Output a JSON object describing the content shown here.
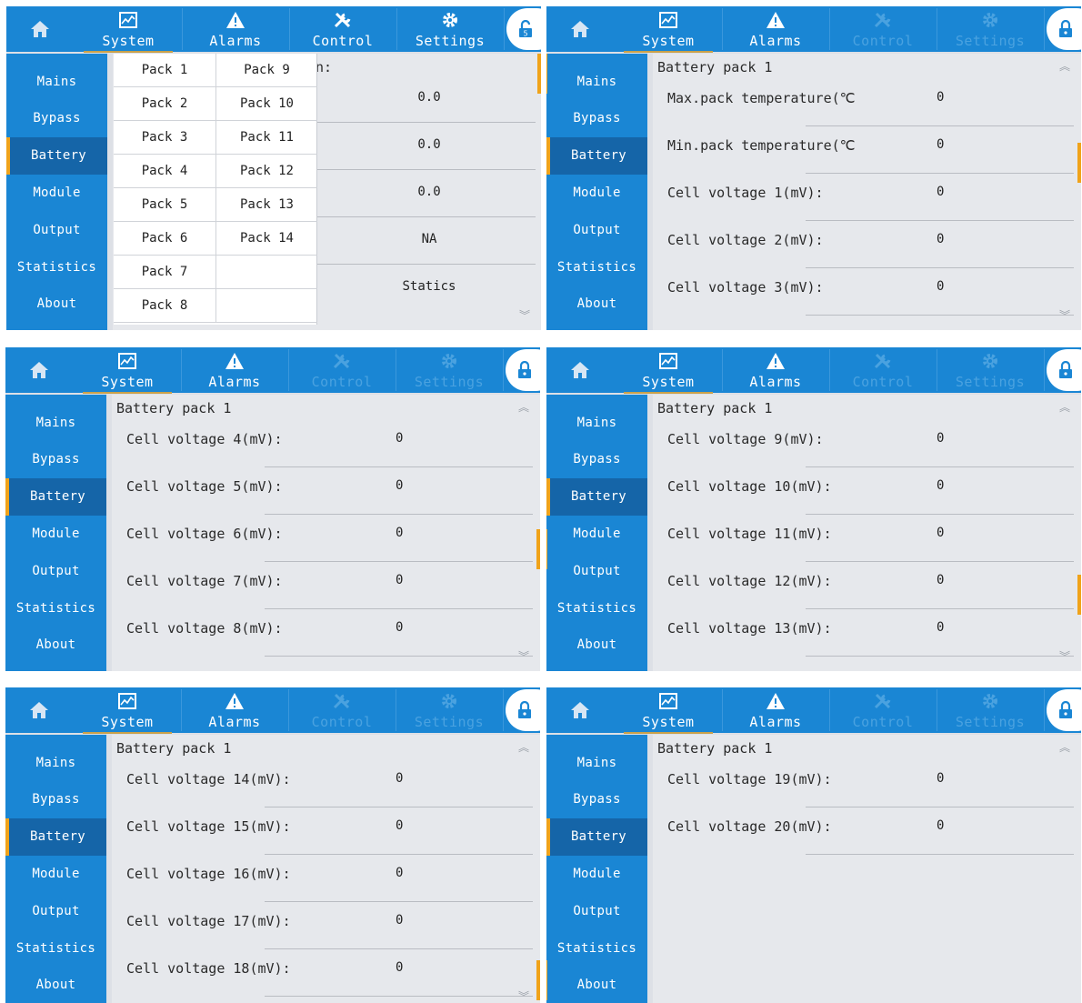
{
  "nav": {
    "system": "System",
    "alarms": "Alarms",
    "control": "Control",
    "settings": "Settings"
  },
  "sidebar": [
    "Mains",
    "Bypass",
    "Battery",
    "Module",
    "Output",
    "Statistics",
    "About"
  ],
  "colors": {
    "bar": "#1a86d4",
    "active": "#1565a8",
    "accent": "#f0a31a"
  },
  "panel1": {
    "partial_title": "n:",
    "packs_left": [
      "Pack 1",
      "Pack 2",
      "Pack 3",
      "Pack 4",
      "Pack 5",
      "Pack 6",
      "Pack 7",
      "Pack 8"
    ],
    "packs_right": [
      "Pack 9",
      "Pack 10",
      "Pack 11",
      "Pack 12",
      "Pack 13",
      "Pack 14"
    ],
    "values": [
      "0.0",
      "0.0",
      "0.0",
      "NA",
      "Statics"
    ]
  },
  "title": "Battery pack 1",
  "panel2": [
    {
      "label": "Max.pack temperature(℃",
      "value": "0"
    },
    {
      "label": "Min.pack temperature(℃",
      "value": "0"
    },
    {
      "label": "Cell voltage 1(mV):",
      "value": "0"
    },
    {
      "label": "Cell voltage 2(mV):",
      "value": "0"
    },
    {
      "label": "Cell voltage 3(mV):",
      "value": "0"
    }
  ],
  "panel3": [
    {
      "label": "Cell voltage 4(mV):",
      "value": "0"
    },
    {
      "label": "Cell voltage 5(mV):",
      "value": "0"
    },
    {
      "label": "Cell voltage 6(mV):",
      "value": "0"
    },
    {
      "label": "Cell voltage 7(mV):",
      "value": "0"
    },
    {
      "label": "Cell voltage 8(mV):",
      "value": "0"
    }
  ],
  "panel4": [
    {
      "label": "Cell voltage 9(mV):",
      "value": "0"
    },
    {
      "label": "Cell voltage 10(mV):",
      "value": "0"
    },
    {
      "label": "Cell voltage 11(mV):",
      "value": "0"
    },
    {
      "label": "Cell voltage 12(mV):",
      "value": "0"
    },
    {
      "label": "Cell voltage 13(mV):",
      "value": "0"
    }
  ],
  "panel5": [
    {
      "label": "Cell voltage 14(mV):",
      "value": "0"
    },
    {
      "label": "Cell voltage 15(mV):",
      "value": "0"
    },
    {
      "label": "Cell voltage 16(mV):",
      "value": "0"
    },
    {
      "label": "Cell voltage 17(mV):",
      "value": "0"
    },
    {
      "label": "Cell voltage 18(mV):",
      "value": "0"
    }
  ],
  "panel6": [
    {
      "label": "Cell voltage 19(mV):",
      "value": "0"
    },
    {
      "label": "Cell voltage 20(mV):",
      "value": "0"
    }
  ]
}
